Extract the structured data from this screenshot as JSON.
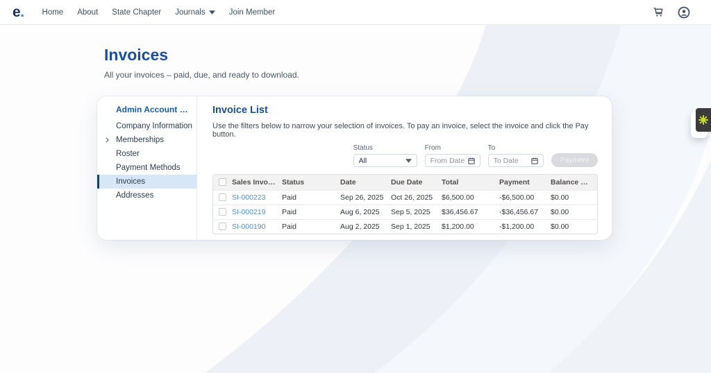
{
  "nav": {
    "logo_text": "e",
    "logo_dot": ".",
    "items": [
      {
        "label": "Home",
        "has_caret": false
      },
      {
        "label": "About",
        "has_caret": false
      },
      {
        "label": "State Chapter",
        "has_caret": false
      },
      {
        "label": "Journals",
        "has_caret": true
      },
      {
        "label": "Join Member",
        "has_caret": false
      }
    ],
    "icons": [
      "cart-icon",
      "account-icon"
    ]
  },
  "page": {
    "title": "Invoices",
    "subtitle": "All your invoices – paid, due, and ready to download."
  },
  "sidebar": {
    "title": "Admin Account Setti...",
    "items": [
      {
        "label": "Company Information",
        "selected": false,
        "has_chevron": false
      },
      {
        "label": "Memberships",
        "selected": false,
        "has_chevron": true
      },
      {
        "label": "Roster",
        "selected": false,
        "has_chevron": false
      },
      {
        "label": "Payment Methods",
        "selected": false,
        "has_chevron": false
      },
      {
        "label": "Invoices",
        "selected": true,
        "has_chevron": false
      },
      {
        "label": "Addresses",
        "selected": false,
        "has_chevron": false
      }
    ]
  },
  "panel": {
    "title": "Invoice List",
    "description": "Use the filters below to narrow your selection of invoices. To pay an invoice, select the invoice and click the Pay button.",
    "filters": {
      "status_label": "Status",
      "status_value": "All",
      "from_label": "From",
      "from_placeholder": "From Date",
      "to_label": "To",
      "to_placeholder": "To Date",
      "payment_button": "Payment"
    },
    "table": {
      "columns": [
        "Sales Invoice N...",
        "Status",
        "Date",
        "Due Date",
        "Total",
        "Payment",
        "Balance Due"
      ],
      "rows": [
        {
          "invoice": "SI-000223",
          "status": "Paid",
          "date": "Sep 26, 2025",
          "due_date": "Oct 26, 2025",
          "total": "$6,500.00",
          "payment": "-$6,500.00",
          "balance_due": "$0.00"
        },
        {
          "invoice": "SI-000219",
          "status": "Paid",
          "date": "Aug 6, 2025",
          "due_date": "Sep 5, 2025",
          "total": "$36,456.67",
          "payment": "-$36,456.67",
          "balance_due": "$0.00"
        },
        {
          "invoice": "SI-000190",
          "status": "Paid",
          "date": "Aug 2, 2025",
          "due_date": "Sep 1, 2025",
          "total": "$1,200.00",
          "payment": "-$1,200.00",
          "balance_due": "$0.00"
        }
      ]
    }
  },
  "widget": {
    "icon": "asterisk-icon"
  },
  "colors": {
    "heading_blue": "#1b4f9e",
    "link_blue": "#4d8fd0",
    "logo_navy": "#16325c",
    "logo_dot_blue": "#1589ee",
    "selected_item_bg": "#d8e7f8",
    "selected_item_border": "#1b4167",
    "table_header_bg": "#f3f2f2",
    "disabled_button_bg": "#d8dadd",
    "widget_bg": "#3b3b3b",
    "widget_icon": "#c8db2b"
  }
}
